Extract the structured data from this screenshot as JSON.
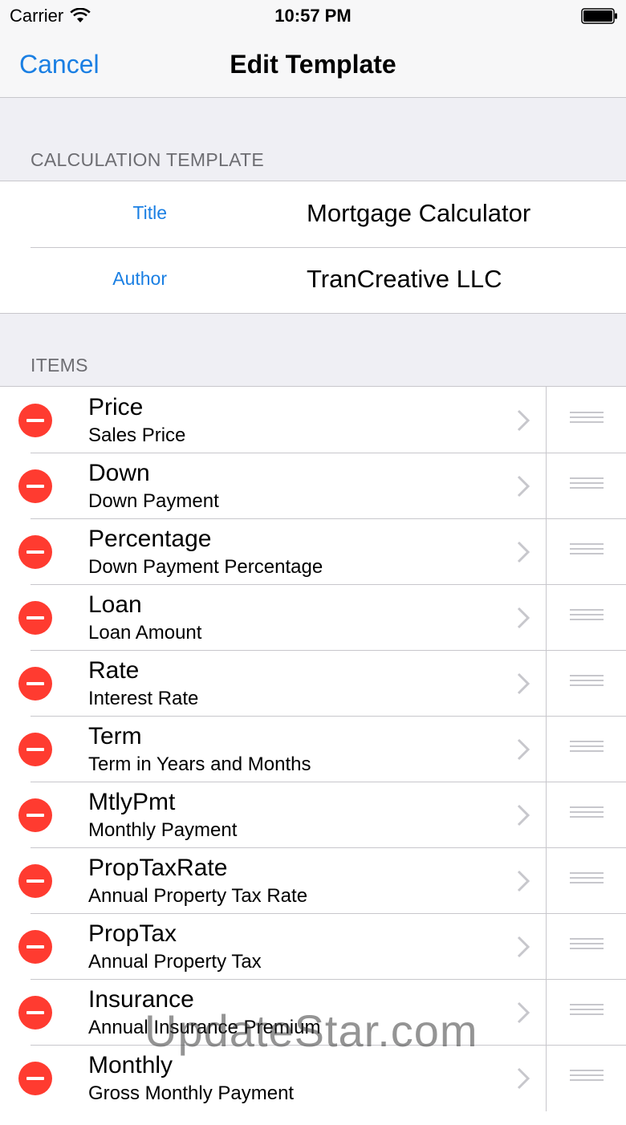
{
  "status_bar": {
    "carrier": "Carrier",
    "time": "10:57 PM",
    "wifi_icon": "wifi-icon",
    "battery_icon": "battery-icon"
  },
  "nav": {
    "cancel_label": "Cancel",
    "title": "Edit Template"
  },
  "template_section": {
    "header": "CALCULATION TEMPLATE",
    "fields": [
      {
        "label": "Title",
        "value": "Mortgage Calculator"
      },
      {
        "label": "Author",
        "value": "TranCreative LLC"
      }
    ]
  },
  "items_section": {
    "header": "ITEMS",
    "items": [
      {
        "name": "Price",
        "description": "Sales Price"
      },
      {
        "name": "Down",
        "description": "Down Payment"
      },
      {
        "name": "Percentage",
        "description": "Down Payment Percentage"
      },
      {
        "name": "Loan",
        "description": "Loan Amount"
      },
      {
        "name": "Rate",
        "description": "Interest Rate"
      },
      {
        "name": "Term",
        "description": "Term in Years and Months"
      },
      {
        "name": "MtlyPmt",
        "description": "Monthly Payment"
      },
      {
        "name": "PropTaxRate",
        "description": "Annual Property Tax Rate"
      },
      {
        "name": "PropTax",
        "description": "Annual Property Tax"
      },
      {
        "name": "Insurance",
        "description": "Annual Insurance Premium"
      },
      {
        "name": "Monthly",
        "description": "Gross Monthly Payment"
      }
    ]
  },
  "watermark": "UpdateStar.com",
  "colors": {
    "accent": "#1a7fe3",
    "delete": "#ff3b30",
    "separator": "#c8c7cc",
    "background": "#efeff4"
  }
}
